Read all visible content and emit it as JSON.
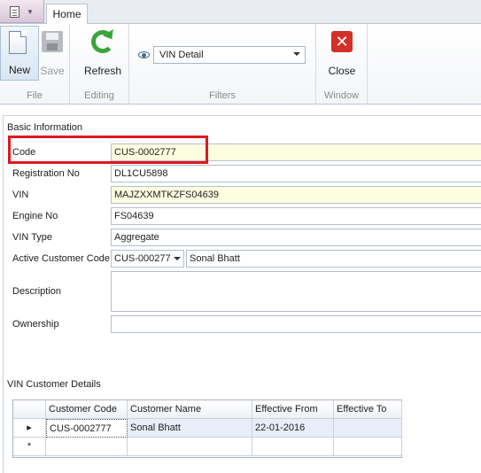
{
  "ribbon": {
    "tab_home": "Home",
    "file_group": {
      "label": "File",
      "new_label": "New",
      "save_label": "Save"
    },
    "editing_group": {
      "label": "Editing",
      "refresh_label": "Refresh"
    },
    "filters_group": {
      "label": "Filters",
      "selected": "VIN Detail"
    },
    "window_group": {
      "label": "Window",
      "close_label": "Close"
    }
  },
  "basic_info": {
    "title": "Basic Information",
    "code_label": "Code",
    "code_value": "CUS-0002777",
    "registration_label": "Registration No",
    "registration_value": "DL1CU5898",
    "vin_label": "VIN",
    "vin_value": "MAJZXXMTKZFS04639",
    "engine_label": "Engine No",
    "engine_value": "FS04639",
    "vin_type_label": "VIN Type",
    "vin_type_value": "Aggregate",
    "active_customer_label": "Active Customer Code",
    "active_customer_code": "CUS-000277",
    "active_customer_name": "Sonal Bhatt",
    "description_label": "Description",
    "description_value": "",
    "ownership_label": "Ownership",
    "ownership_value": ""
  },
  "vin_customer_details": {
    "title": "VIN Customer Details",
    "columns": [
      "Customer Code",
      "Customer Name",
      "Effective From",
      "Effective To"
    ],
    "rows": [
      [
        "CUS-0002777",
        "Sonal Bhatt",
        "22-01-2016",
        ""
      ]
    ],
    "row_indicator": "▸",
    "new_row_indicator": "*"
  },
  "colors": {
    "highlight_border": "#e0171f",
    "required_field_bg": "#fdfde1",
    "close_icon_bg": "#d2302a",
    "refresh_icon": "#3aa53a"
  },
  "icons": [
    "app-menu-icon",
    "new-document-icon",
    "save-disk-icon",
    "refresh-icon",
    "eye-icon",
    "dropdown-arrow-icon",
    "close-x-icon"
  ]
}
